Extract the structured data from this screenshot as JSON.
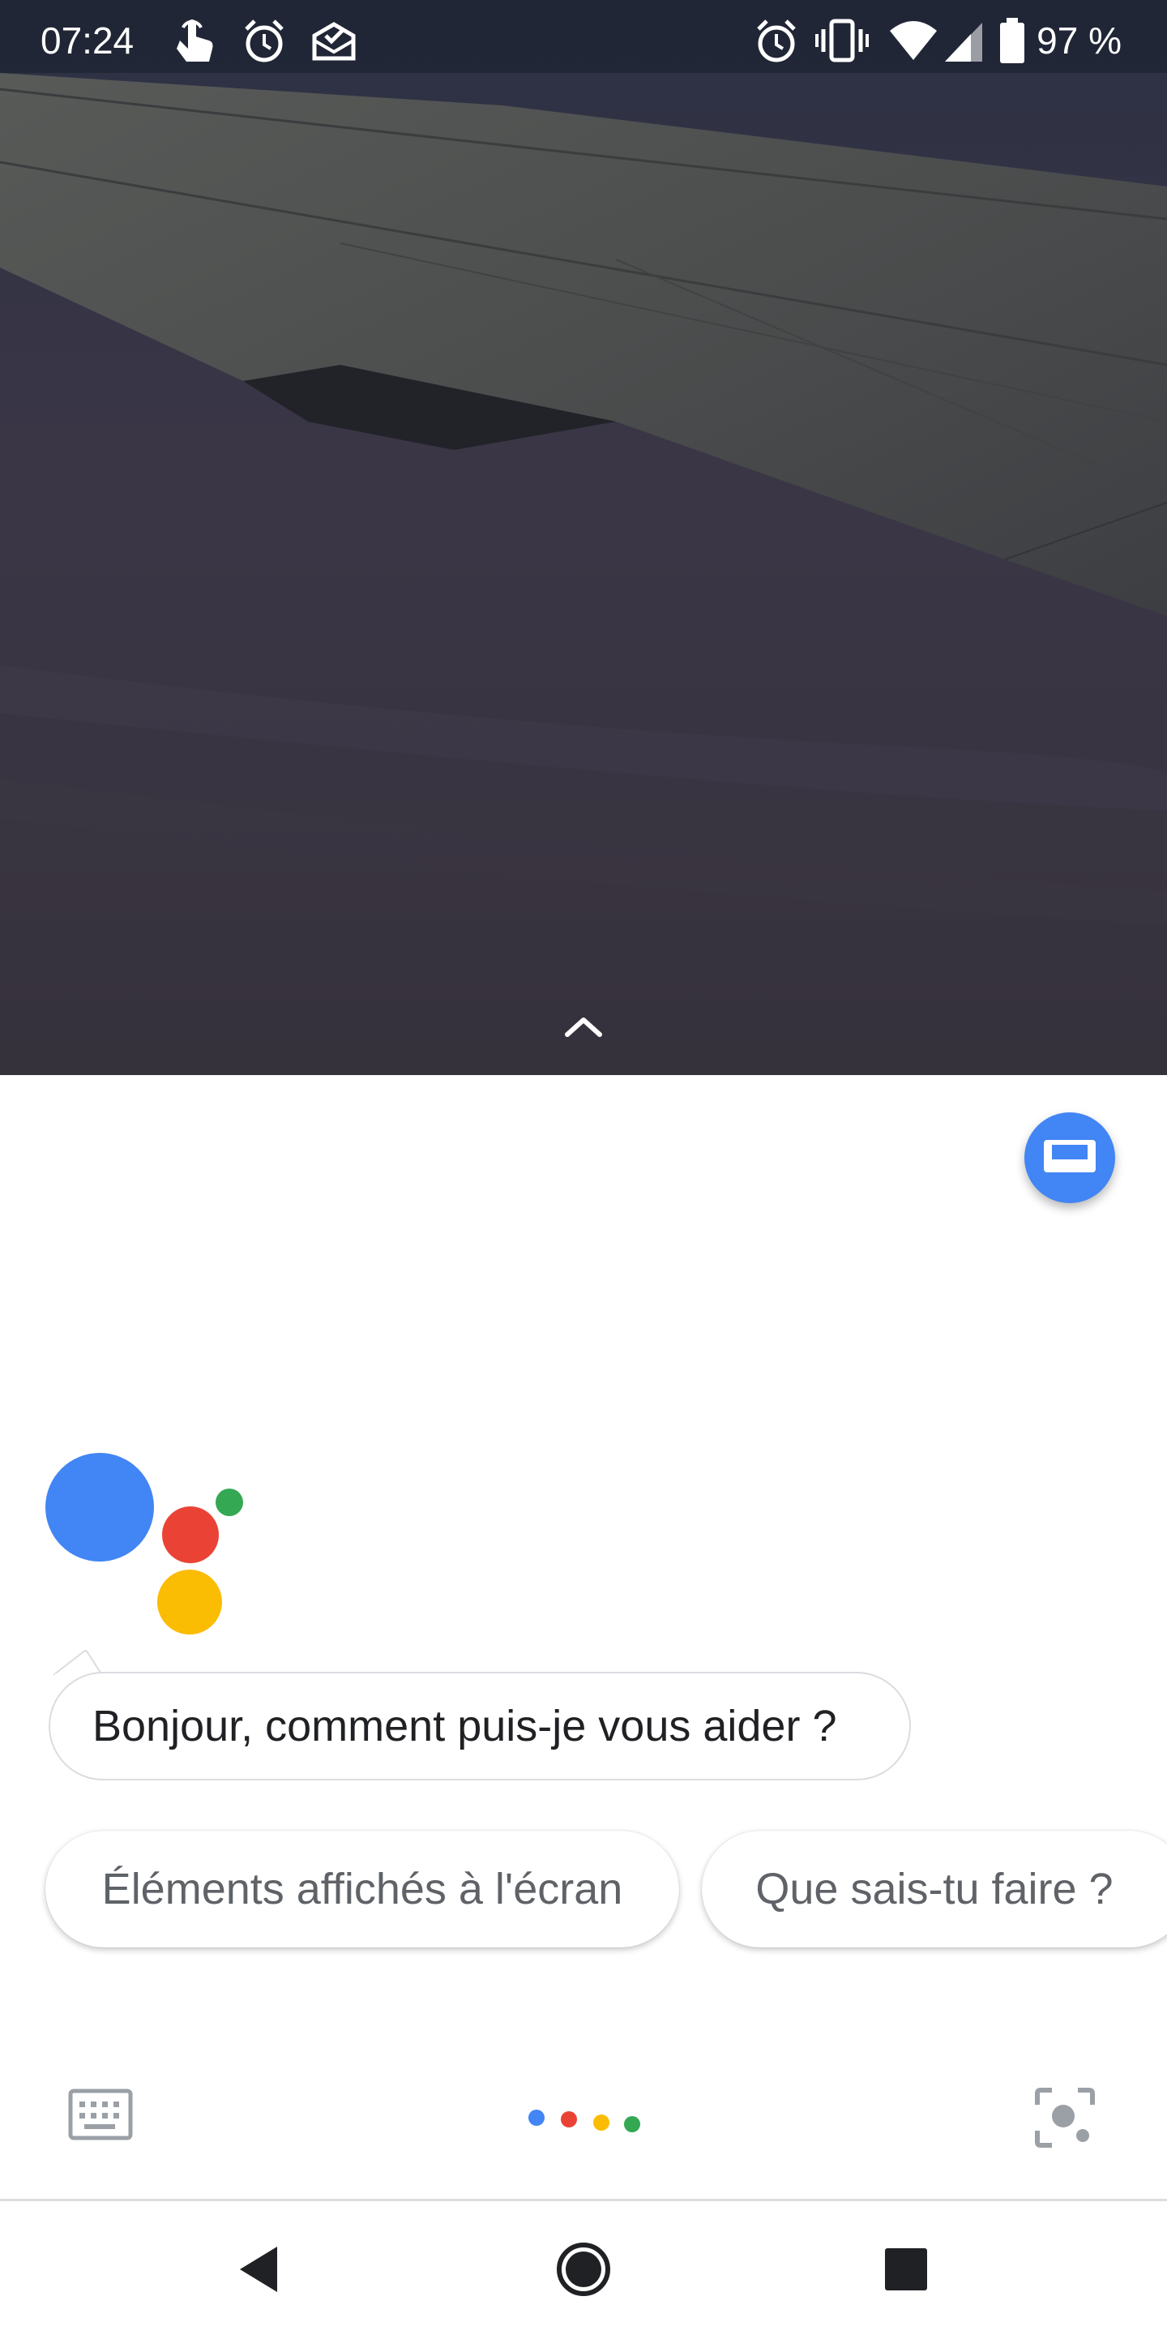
{
  "status_bar": {
    "time": "07:24",
    "left_icons": [
      "touch-gesture-icon",
      "alarm-icon",
      "mail-done-icon"
    ],
    "right_icons": [
      "alarm-icon",
      "vibrate-icon",
      "wifi-icon",
      "cell-signal-icon",
      "battery-icon"
    ],
    "battery_percent": "97 %"
  },
  "wallpaper": {
    "description_icon": "airplane-wing-wallpaper"
  },
  "assistant": {
    "greeting": "Bonjour, comment puis-je vous aider ?",
    "suggestions": [
      {
        "label": "Éléments affichés à l'écran"
      },
      {
        "label": "Que sais-tu faire ?"
      }
    ],
    "colors": {
      "blue": "#4285f4",
      "red": "#ea4335",
      "yellow": "#fbbc04",
      "green": "#34a853"
    }
  },
  "navigation": {
    "buttons": [
      "back-icon",
      "home-icon",
      "recents-icon"
    ]
  }
}
